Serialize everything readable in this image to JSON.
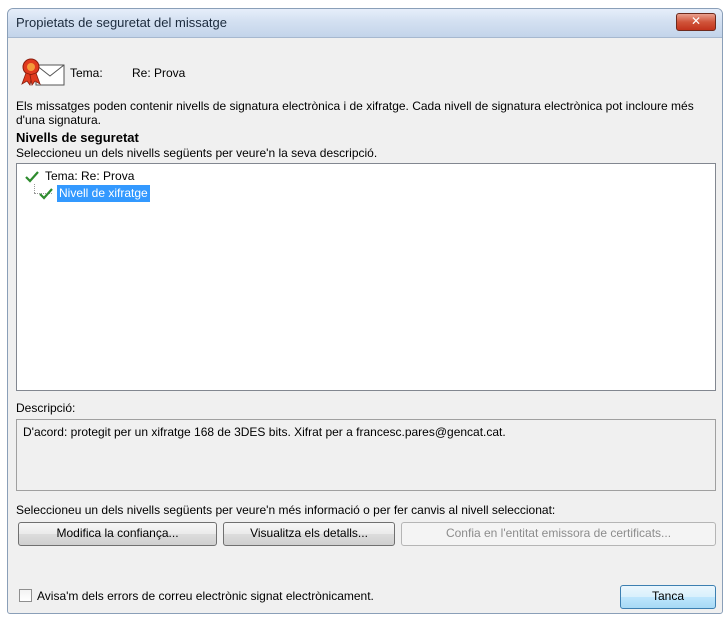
{
  "window": {
    "title": "Propietats de seguretat del missatge",
    "close_label": "✕"
  },
  "subject": {
    "label": "Tema:",
    "value": "Re: Prova"
  },
  "intro_text": "Els missatges poden contenir nivells de signatura electrònica i de xifratge. Cada nivell de signatura electrònica pot incloure més d'una signatura.",
  "security_levels": {
    "title": "Nivells de seguretat",
    "hint": "Seleccioneu un dels nivells següents per veure'n la seva descripció.",
    "items": [
      {
        "label": "Tema: Re: Prova",
        "selected": false,
        "icon": "check-icon"
      },
      {
        "label": "Nivell de xifratge",
        "selected": true,
        "icon": "check-icon"
      }
    ]
  },
  "description": {
    "label": "Descripció:",
    "text": "D'acord: protegit per un xifratge 168 de 3DES bits. Xifrat per a francesc.pares@gencat.cat."
  },
  "actions": {
    "hint": "Seleccioneu un dels nivells següents per veure'n més informació o per fer canvis al nivell seleccionat:",
    "modify_trust": "Modifica la confiança...",
    "view_details": "Visualitza els detalls...",
    "trust_ca": "Confia en l'entitat emissora de certificats..."
  },
  "footer": {
    "warn_checkbox_label": "Avisa'm dels errors de correu electrònic signat electrònicament.",
    "warn_checked": false,
    "close_button": "Tanca"
  },
  "colors": {
    "selection": "#3399ff",
    "check": "#2e8b2e",
    "close_button": "#c2331c"
  }
}
